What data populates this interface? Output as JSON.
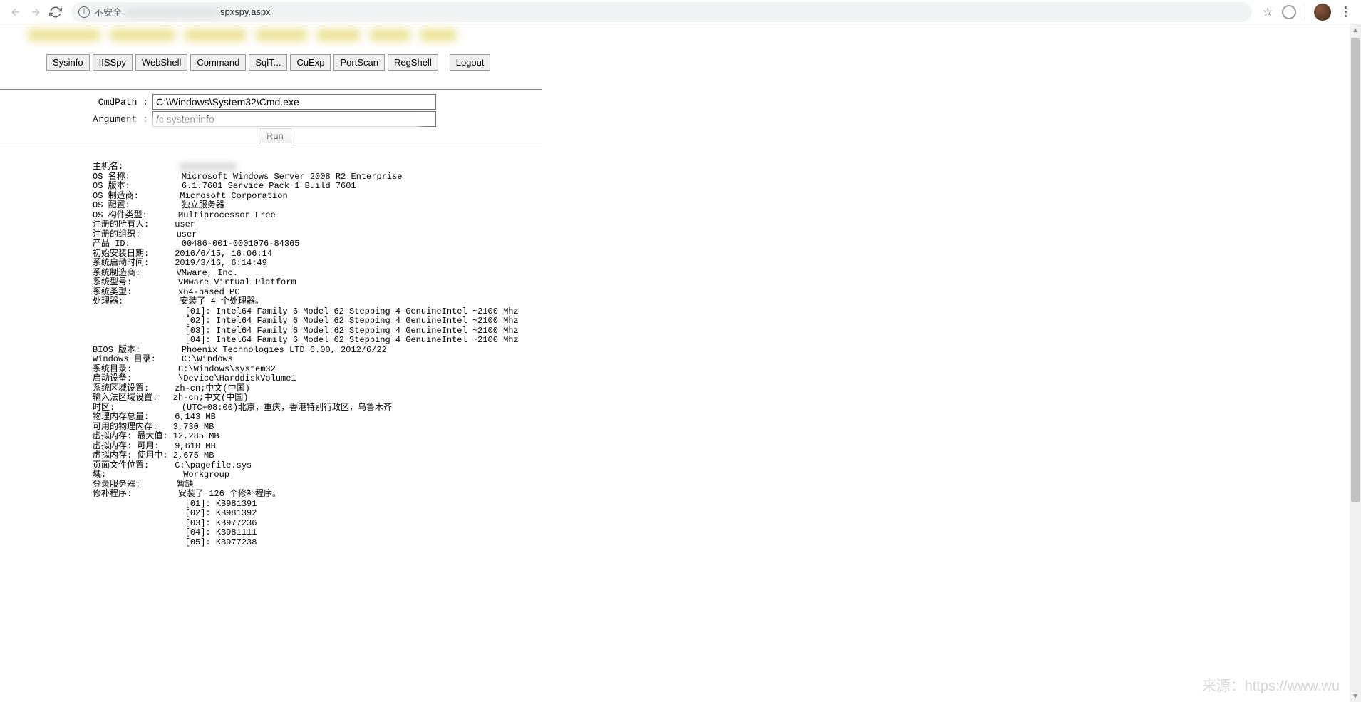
{
  "browser": {
    "not_secure": "不安全",
    "url_suffix": "spxspy.aspx"
  },
  "tabs": {
    "sysinfo": "Sysinfo",
    "iisspy": "IISSpy",
    "webshell": "WebShell",
    "command": "Command",
    "btn5": "SqlT...",
    "btn6": "CuExp",
    "portscan": "PortScan",
    "regshell": "RegShell",
    "logout": "Logout"
  },
  "form": {
    "cmdpath_label": "CmdPath  :",
    "cmdpath_value": "C:\\Windows\\System32\\Cmd.exe",
    "argument_label": "Argument  :",
    "argument_value": "/c systeminfo",
    "run": "Run"
  },
  "output": {
    "lines": [
      {
        "label": "主机名:",
        "value": "[REDACTED]"
      },
      {
        "label": "OS 名称:",
        "value": "Microsoft Windows Server 2008 R2 Enterprise"
      },
      {
        "label": "OS 版本:",
        "value": "6.1.7601 Service Pack 1 Build 7601"
      },
      {
        "label": "OS 制造商:",
        "value": "Microsoft Corporation"
      },
      {
        "label": "OS 配置:",
        "value": "独立服务器"
      },
      {
        "label": "OS 构件类型:",
        "value": "Multiprocessor Free"
      },
      {
        "label": "注册的所有人:",
        "value": "user"
      },
      {
        "label": "注册的组织:",
        "value": "user"
      },
      {
        "label": "产品 ID:",
        "value": "00486-001-0001076-84365"
      },
      {
        "label": "初始安装日期:",
        "value": "2016/6/15, 16:06:14"
      },
      {
        "label": "系统启动时间:",
        "value": "2019/3/16, 6:14:49"
      },
      {
        "label": "系统制造商:",
        "value": "VMware, Inc."
      },
      {
        "label": "系统型号:",
        "value": "VMware Virtual Platform"
      },
      {
        "label": "系统类型:",
        "value": "x64-based PC"
      },
      {
        "label": "处理器:",
        "value": "安装了 4 个处理器。"
      },
      {
        "label": "",
        "value": "[01]: Intel64 Family 6 Model 62 Stepping 4 GenuineIntel ~2100 Mhz"
      },
      {
        "label": "",
        "value": "[02]: Intel64 Family 6 Model 62 Stepping 4 GenuineIntel ~2100 Mhz"
      },
      {
        "label": "",
        "value": "[03]: Intel64 Family 6 Model 62 Stepping 4 GenuineIntel ~2100 Mhz"
      },
      {
        "label": "",
        "value": "[04]: Intel64 Family 6 Model 62 Stepping 4 GenuineIntel ~2100 Mhz"
      },
      {
        "label": "BIOS 版本:",
        "value": "Phoenix Technologies LTD 6.00, 2012/6/22"
      },
      {
        "label": "Windows 目录:",
        "value": "C:\\Windows"
      },
      {
        "label": "系统目录:",
        "value": "C:\\Windows\\system32"
      },
      {
        "label": "启动设备:",
        "value": "\\Device\\HarddiskVolume1"
      },
      {
        "label": "系统区域设置:",
        "value": "zh-cn;中文(中国)"
      },
      {
        "label": "输入法区域设置:",
        "value": "zh-cn;中文(中国)"
      },
      {
        "label": "时区:",
        "value": "(UTC+08:00)北京，重庆，香港特别行政区，乌鲁木齐"
      },
      {
        "label": "物理内存总量:",
        "value": "6,143 MB"
      },
      {
        "label": "可用的物理内存:",
        "value": "3,730 MB"
      },
      {
        "label": "虚拟内存: 最大值:",
        "value": "12,285 MB"
      },
      {
        "label": "虚拟内存: 可用:",
        "value": "9,610 MB"
      },
      {
        "label": "虚拟内存: 使用中:",
        "value": "2,675 MB"
      },
      {
        "label": "页面文件位置:",
        "value": "C:\\pagefile.sys"
      },
      {
        "label": "域:",
        "value": "Workgroup"
      },
      {
        "label": "登录服务器:",
        "value": "暂缺"
      },
      {
        "label": "修补程序:",
        "value": "安装了 126 个修补程序。"
      },
      {
        "label": "",
        "value": "[01]: KB981391"
      },
      {
        "label": "",
        "value": "[02]: KB981392"
      },
      {
        "label": "",
        "value": "[03]: KB977236"
      },
      {
        "label": "",
        "value": "[04]: KB981111"
      },
      {
        "label": "",
        "value": "[05]: KB977238"
      }
    ]
  },
  "watermark": "来源：https://www.wu"
}
